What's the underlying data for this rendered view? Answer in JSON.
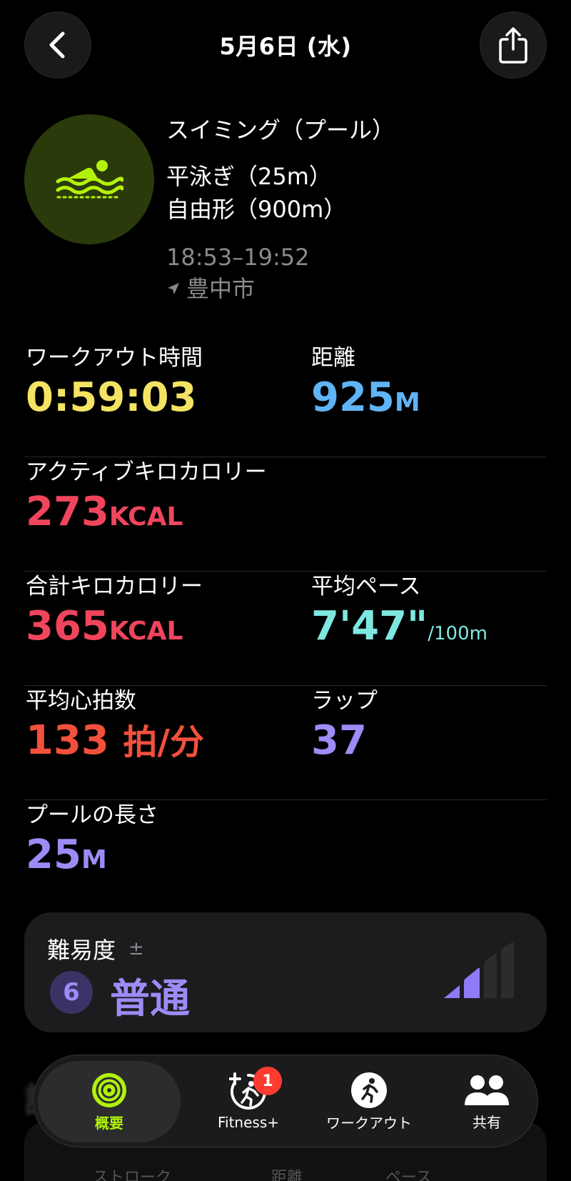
{
  "header": {
    "date": "5月6日 (水)"
  },
  "workout": {
    "title": "スイミング（プール）",
    "strokes": [
      "平泳ぎ（25m）",
      "自由形（900m）"
    ],
    "time_range": "18:53–19:52",
    "location": "豊中市",
    "icon": "pool-swim-icon",
    "accent_color": "#b2f20a"
  },
  "metrics": {
    "workout_time": {
      "label": "ワークアウト時間",
      "value": "0:59:03"
    },
    "distance": {
      "label": "距離",
      "value": "925",
      "unit": "M"
    },
    "active_kcal": {
      "label": "アクティブキロカロリー",
      "value": "273",
      "unit": "KCAL"
    },
    "total_kcal": {
      "label": "合計キロカロリー",
      "value": "365",
      "unit": "KCAL"
    },
    "avg_pace": {
      "label": "平均ペース",
      "value": "7'47\"",
      "unit": "/100m"
    },
    "avg_hr": {
      "label": "平均心拍数",
      "value": "133",
      "unit": "拍/分"
    },
    "laps": {
      "label": "ラップ",
      "value": "37"
    },
    "pool_length": {
      "label": "プールの長さ",
      "value": "25",
      "unit": "M"
    }
  },
  "effort": {
    "title": "難易度",
    "adjust_symbol": "±",
    "score": "6",
    "label": "普通",
    "bars_filled": 2,
    "bars_total": 4
  },
  "peek": {
    "col1": "ストローク",
    "col2": "距離",
    "col3": "ペース"
  },
  "tabbar": {
    "tabs": [
      {
        "label": "概要",
        "icon": "activity-rings-icon",
        "selected": true
      },
      {
        "label": "Fitness+",
        "icon": "fitness-plus-icon",
        "badge": "1"
      },
      {
        "label": "ワークアウト",
        "icon": "running-figure-icon"
      },
      {
        "label": "共有",
        "icon": "people-icon"
      }
    ]
  },
  "colors": {
    "yellow": "#f5e463",
    "blue": "#5fb4f6",
    "red": "#f0455d",
    "cyan": "#7ee8e0",
    "purple": "#9b8cf6"
  }
}
